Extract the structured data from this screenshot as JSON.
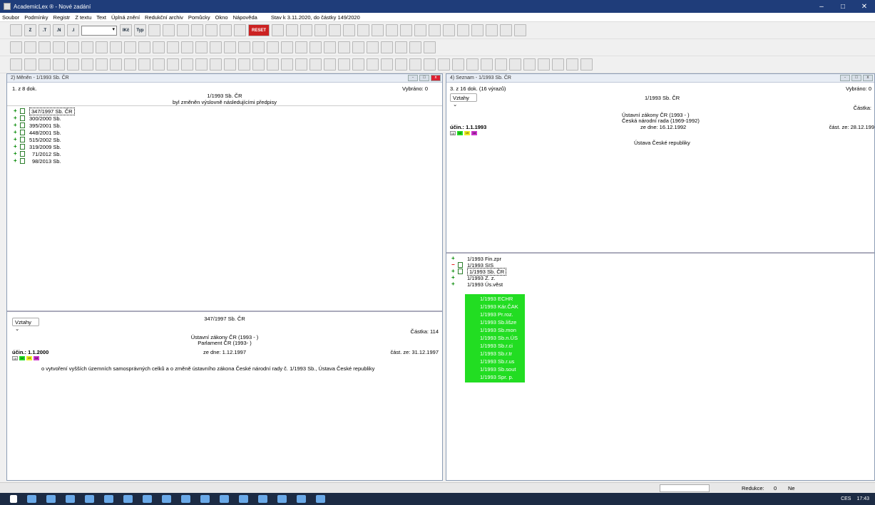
{
  "window": {
    "title": "AcademicLex ® - Nové zadání",
    "minimize": "–",
    "maximize": "□",
    "close": "✕"
  },
  "menu": {
    "items": [
      "Soubor",
      "Podmínky",
      "Registr",
      "Z textu",
      "Text",
      "Úplná znění",
      "Redukční archiv",
      "Pomůcky",
      "Okno",
      "Nápověda"
    ],
    "status": "Stav k 3.11.2020, do částky 149/2020"
  },
  "toolbar": {
    "z_label": "Z",
    "t_label": ".T",
    "n_label": ".N",
    "i_label": ".I",
    "ikc_label": "IKč",
    "typ_label": "Typ",
    "reset_label": "RESET"
  },
  "left_window": {
    "title": "2) Měněn - 1/1993 Sb. ČR",
    "doc_count": "1. z 8 dok.",
    "selected": "Vybráno: 0",
    "heading": "1/1993 Sb. ČR",
    "subheading": "byl změněn výslovně následujícími předpisy",
    "items": [
      {
        "text": "347/1997 Sb. ČR"
      },
      {
        "text": "300/2000 Sb."
      },
      {
        "text": "395/2001 Sb."
      },
      {
        "text": "448/2001 Sb."
      },
      {
        "text": "515/2002 Sb."
      },
      {
        "text": "319/2009 Sb."
      },
      {
        "text": "71/2012 Sb."
      },
      {
        "text": "98/2013 Sb."
      }
    ],
    "detail": {
      "dropdown": "Vztahy",
      "doc": "347/1997 Sb. ČR",
      "castka": "Částka: 114",
      "category1": "Ústavní zákony ČR (1993 -   )",
      "category2": "Parlament ČR (1993-   )",
      "effective": "účin.: 1.1.2000",
      "date": "ze dne: 1.12.1997",
      "part_date": "část. ze: 31.12.1997",
      "badges": [
        "15",
        "12",
        "19",
        "18"
      ],
      "description": "o vytvoření vyšších územních samosprávných celků a o změně ústavního zákona České národní rady č. 1/1993 Sb., Ústava České republiky"
    }
  },
  "right_window": {
    "title": "4) Seznam - 1/1993 Sb. ČR",
    "doc_count": "3. z 16 dok. (16 výrazů)",
    "selected": "Vybráno: 0",
    "dropdown": "Vztahy",
    "doc": "1/1993 Sb. ČR",
    "castka": "Částka:",
    "category1": "Ústavní zákony ČR (1993 -   )",
    "category2": "Česká národní rada (1969-1992)",
    "effective": "účin.: 1.1.1993",
    "date": "ze dne: 16.12.1992",
    "part_date": "část. ze: 28.12.199",
    "badges": [
      "15",
      "12",
      "19",
      "18"
    ],
    "name": "Ústava České republiky",
    "items": [
      "1/1993 Fin.zpr",
      "1/1993 SIS",
      "1/1993 Sb. ČR",
      "1/1993 Z. z.",
      "1/1993 Ús.věst"
    ],
    "green_items": [
      "1/1993 ECHR",
      "1/1993 Kár.ČAK",
      "1/1993 Pr.roz.",
      "1/1993 Sb.lišze",
      "1/1993 Sb.mon",
      "1/1993 Sb.n.ÚS",
      "1/1993 Sb.r.ci",
      "1/1993 Sb.r.tr",
      "1/1993 Sb.r.us",
      "1/1993 Sb.sout",
      "1/1993 Spr. p."
    ]
  },
  "bottom": {
    "redukce": "Redukce:",
    "redukce_val": "0",
    "ne": "Ne"
  },
  "taskbar": {
    "lang": "CES",
    "time": "17:43"
  },
  "colors": {
    "titlebar": "#1f3d7a",
    "highlight": "#22dd22",
    "taskbar": "#1c2b44"
  }
}
